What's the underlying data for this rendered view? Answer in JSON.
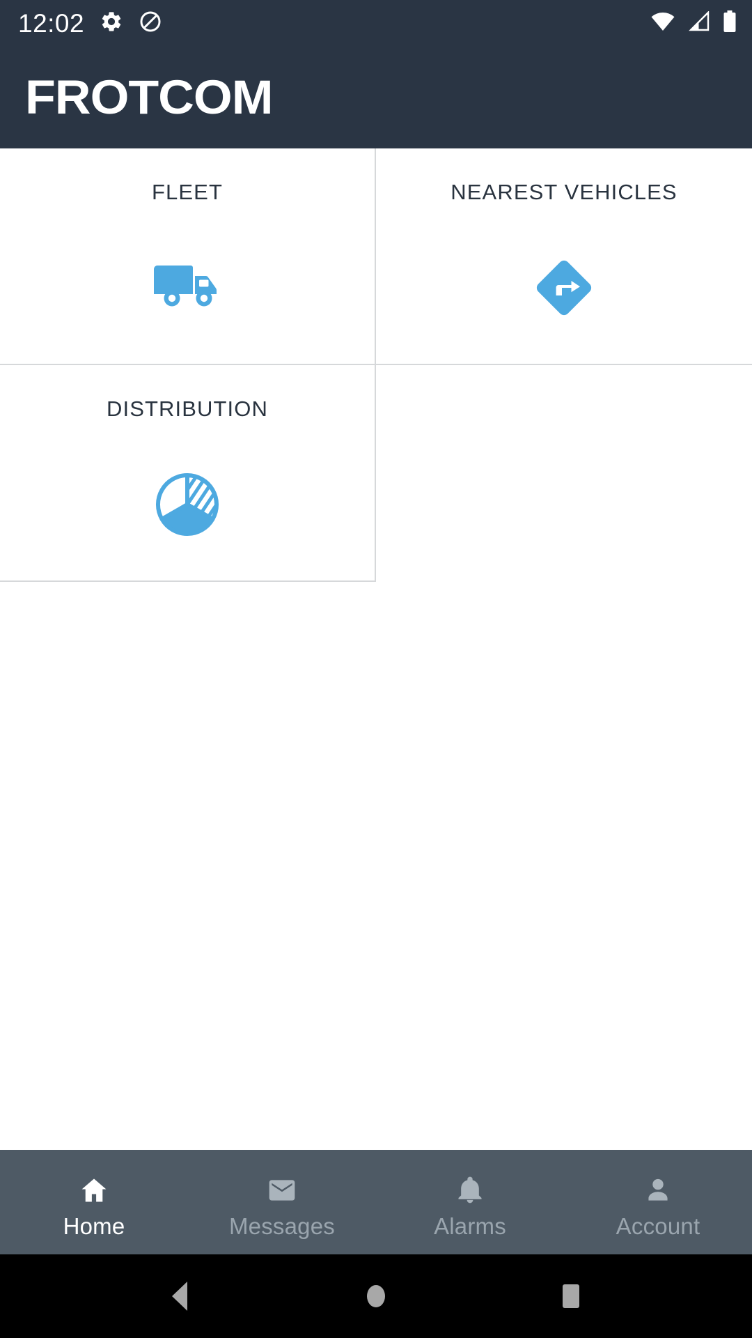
{
  "status_bar": {
    "time": "12:02",
    "left_icons": [
      "gear-icon",
      "do-not-disturb-icon"
    ],
    "right_icons": [
      "wifi-icon",
      "cell-signal-icon",
      "battery-icon"
    ],
    "background_color": "#2a3544",
    "foreground_color": "#ffffff"
  },
  "app_bar": {
    "brand": "FROTCOM",
    "background_color": "#2a3544",
    "text_color": "#ffffff"
  },
  "tiles": [
    {
      "label": "FLEET",
      "icon": "truck-icon",
      "color": "#4da9e0"
    },
    {
      "label": "NEAREST VEHICLES",
      "icon": "turn-right-diamond-icon",
      "color": "#4da9e0"
    },
    {
      "label": "DISTRIBUTION",
      "icon": "pie-distribution-icon",
      "color": "#4da9e0"
    }
  ],
  "bottom_nav": {
    "background_color": "#4e5a65",
    "active_color": "#ffffff",
    "inactive_color": "#9aa5ae",
    "items": [
      {
        "label": "Home",
        "icon": "home-icon",
        "active": true
      },
      {
        "label": "Messages",
        "icon": "envelope-icon",
        "active": false
      },
      {
        "label": "Alarms",
        "icon": "bell-icon",
        "active": false
      },
      {
        "label": "Account",
        "icon": "person-icon",
        "active": false
      }
    ]
  },
  "system_nav": {
    "background_color": "#000000",
    "icon_color": "#a8a8a8",
    "buttons": [
      "back-triangle-icon",
      "home-circle-icon",
      "recents-square-icon"
    ]
  }
}
